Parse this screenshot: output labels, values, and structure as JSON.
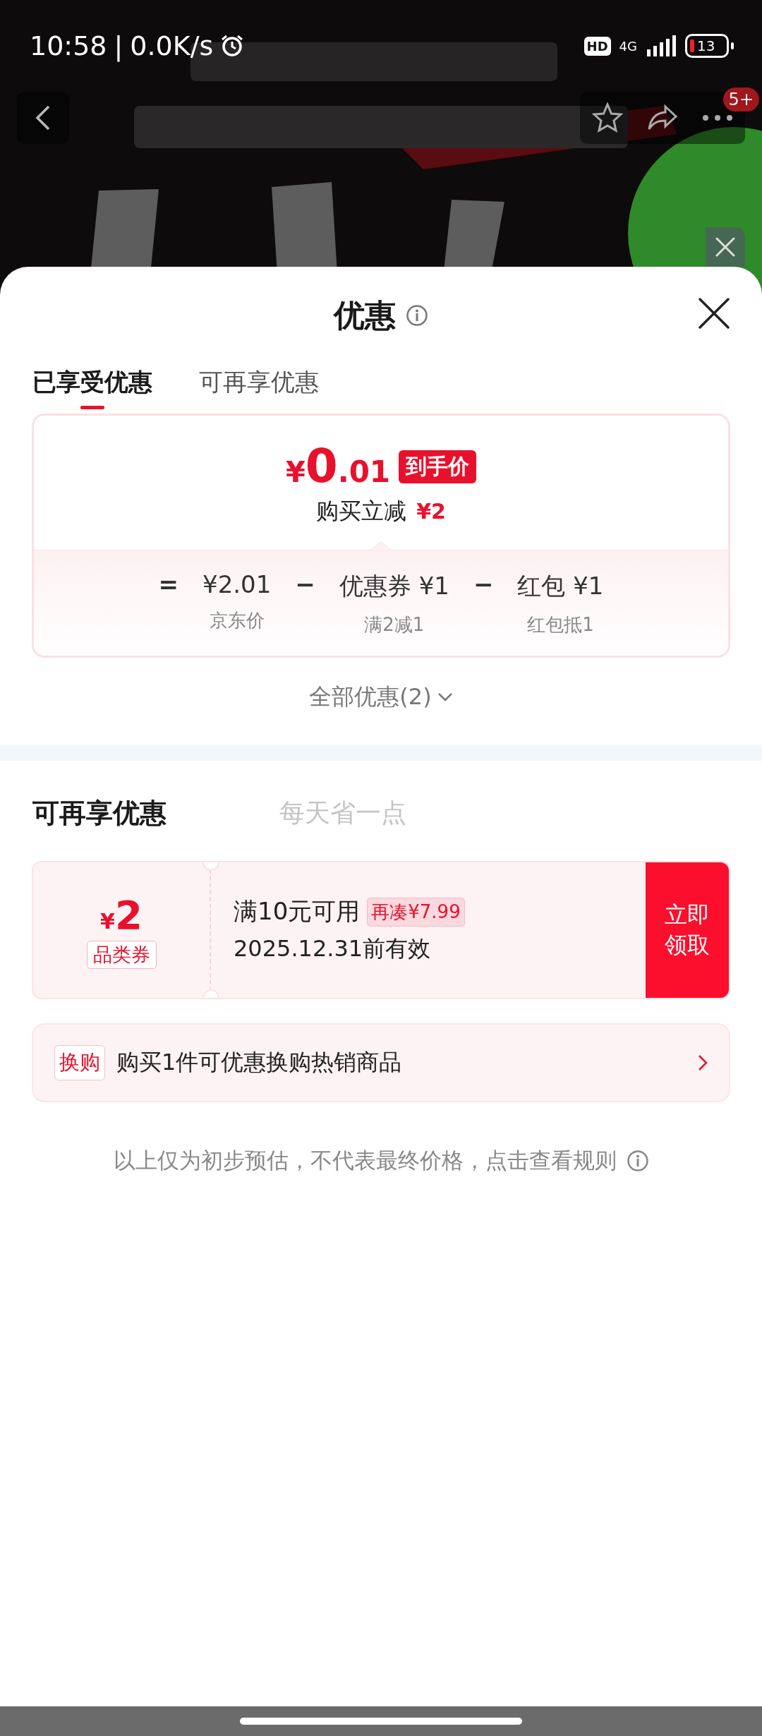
{
  "status_bar": {
    "time": "10:58",
    "separator": "|",
    "speed": "0.0K/s",
    "hd": "HD",
    "network": "4G",
    "battery": "13"
  },
  "top_bar": {
    "badge": "5+"
  },
  "sheet": {
    "title": "优惠",
    "tabs": [
      {
        "label": "已享受优惠",
        "selected": true
      },
      {
        "label": "可再享优惠",
        "selected": false
      }
    ],
    "price_card": {
      "currency": "¥",
      "price_int": "0",
      "price_dec": ".01",
      "price_tag": "到手价",
      "reduce_label": "购买立减",
      "reduce_amount": "¥2",
      "formula": [
        {
          "kind": "op",
          "text": "="
        },
        {
          "kind": "item",
          "text": "¥2.01",
          "note": "京东价"
        },
        {
          "kind": "op",
          "text": "−"
        },
        {
          "kind": "item",
          "text": "优惠券 ¥1",
          "note": "满2减1"
        },
        {
          "kind": "op",
          "text": "−"
        },
        {
          "kind": "item",
          "text": "红包 ¥1",
          "note": "红包抵1"
        }
      ]
    },
    "all_offers": "全部优惠(2)",
    "more_section": {
      "title": "可再享优惠",
      "slogan": "每天省一点",
      "coupon": {
        "currency": "¥",
        "amount": "2",
        "type": "品类券",
        "condition": "满10元可用",
        "hint": "再凑¥7.99",
        "validity": "2025.12.31前有效",
        "action": "立即领取"
      },
      "exchange": {
        "tag": "换购",
        "text": "购买1件可优惠换购热销商品"
      }
    },
    "disclaimer": "以上仅为初步预估，不代表最终价格，点击查看规则"
  }
}
